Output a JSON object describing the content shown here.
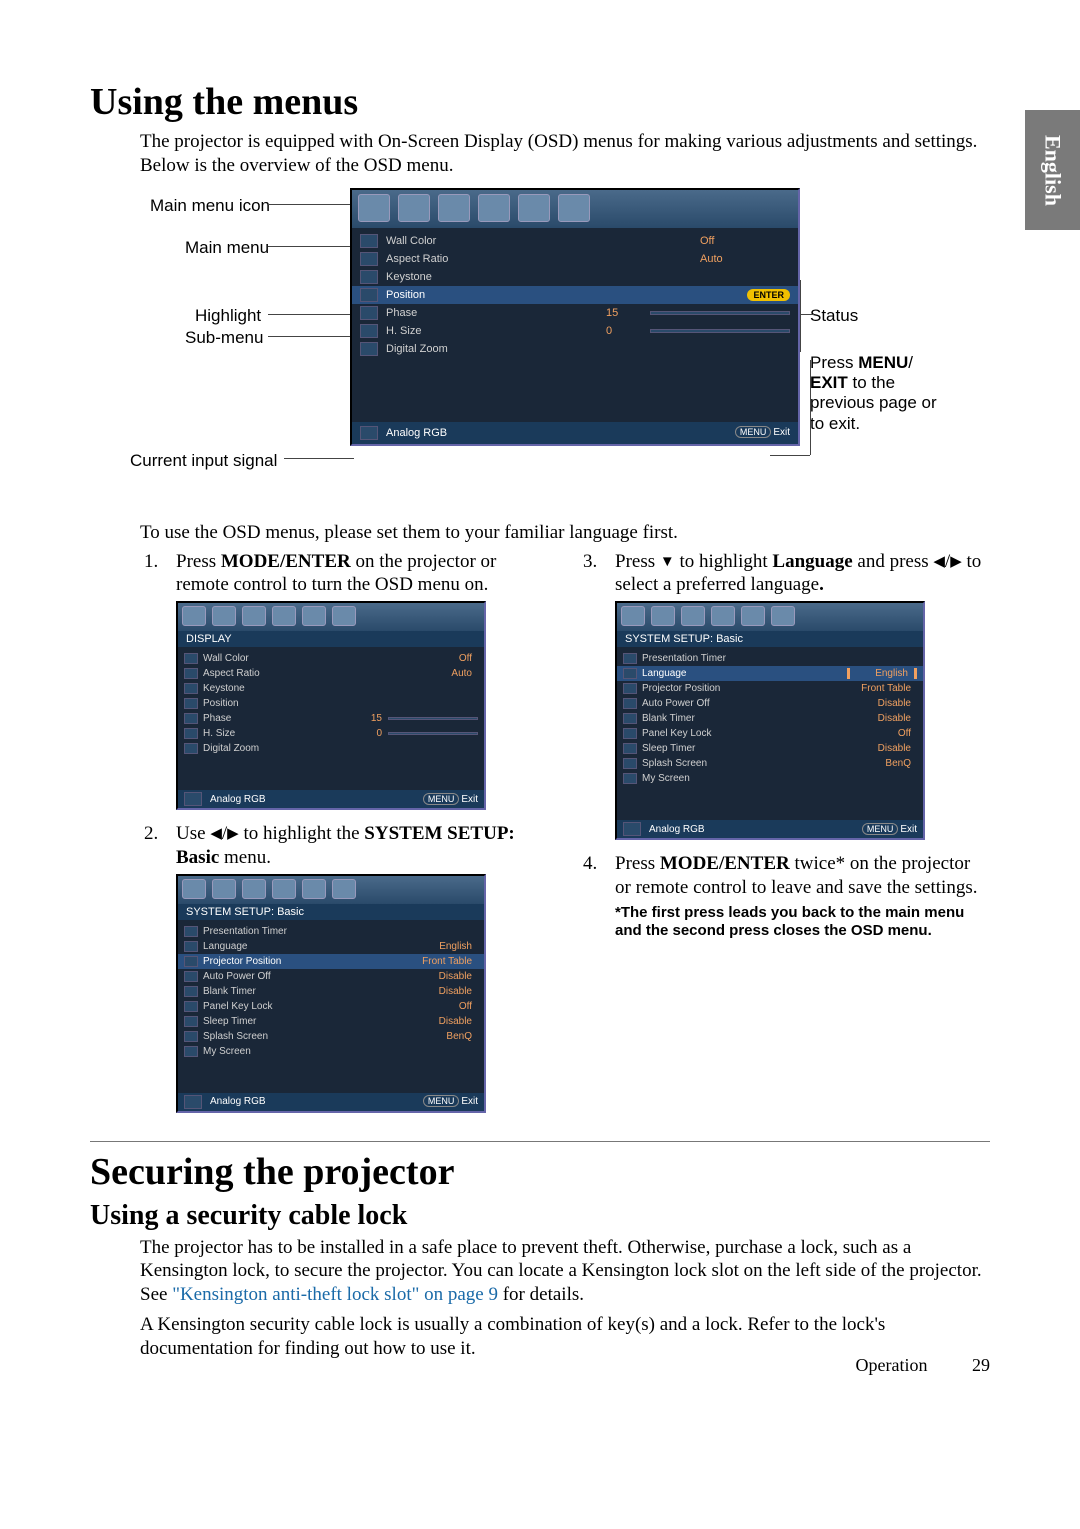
{
  "side_tab": "English",
  "heading1": "Using the menus",
  "intro1": "The projector is equipped with On-Screen Display (OSD) menus for making various adjustments and settings.",
  "intro2": "Below is the overview of the OSD menu.",
  "diagram_labels": {
    "main_menu_icon": "Main menu icon",
    "main_menu": "Main menu",
    "highlight": "Highlight",
    "sub_menu": "Sub-menu",
    "current_input_signal": "Current input signal",
    "status": "Status",
    "press_menu_exit": "Press MENU/EXIT to the previous page or to exit."
  },
  "main_osd": {
    "rows": [
      {
        "name": "Wall Color",
        "value": "Off",
        "type": "value"
      },
      {
        "name": "Aspect Ratio",
        "value": "Auto",
        "type": "value"
      },
      {
        "name": "Keystone",
        "value": "",
        "type": "plain"
      },
      {
        "name": "Position",
        "value": "ENTER",
        "type": "enter",
        "hl": true
      },
      {
        "name": "Phase",
        "value": "15",
        "type": "slider"
      },
      {
        "name": "H. Size",
        "value": "0",
        "type": "slider"
      },
      {
        "name": "Digital Zoom",
        "value": "",
        "type": "plain"
      }
    ],
    "footer_signal": "Analog RGB",
    "footer_menu": "MENU",
    "footer_exit": "Exit"
  },
  "below_text": "To use the OSD menus, please set them to your familiar language first.",
  "step1": {
    "num": "1.",
    "text_a": "Press ",
    "bold_a": "MODE/ENTER",
    "text_b": " on the projector or remote control to turn the OSD menu on."
  },
  "osd1": {
    "title": "DISPLAY",
    "rows": [
      {
        "name": "Wall Color",
        "value": "Off",
        "type": "value"
      },
      {
        "name": "Aspect Ratio",
        "value": "Auto",
        "type": "value"
      },
      {
        "name": "Keystone",
        "value": "",
        "type": "plain"
      },
      {
        "name": "Position",
        "value": "",
        "type": "plain"
      },
      {
        "name": "Phase",
        "value": "15",
        "type": "slider"
      },
      {
        "name": "H. Size",
        "value": "0",
        "type": "slider"
      },
      {
        "name": "Digital Zoom",
        "value": "",
        "type": "plain"
      }
    ],
    "footer_signal": "Analog RGB",
    "footer_menu": "MENU",
    "footer_exit": "Exit"
  },
  "step2": {
    "num": "2.",
    "text_a": "Use ",
    "text_b": " to highlight the ",
    "bold_a": "SYSTEM SETUP: Basic",
    "text_c": " menu."
  },
  "osd2": {
    "title": "SYSTEM SETUP: Basic",
    "rows": [
      {
        "name": "Presentation Timer",
        "value": "",
        "type": "plain"
      },
      {
        "name": "Language",
        "value": "English",
        "type": "value"
      },
      {
        "name": "Projector Position",
        "value": "Front Table",
        "type": "value",
        "hl": true
      },
      {
        "name": "Auto Power Off",
        "value": "Disable",
        "type": "value"
      },
      {
        "name": "Blank Timer",
        "value": "Disable",
        "type": "value"
      },
      {
        "name": "Panel Key Lock",
        "value": "Off",
        "type": "value"
      },
      {
        "name": "Sleep Timer",
        "value": "Disable",
        "type": "value"
      },
      {
        "name": "Splash Screen",
        "value": "BenQ",
        "type": "value"
      },
      {
        "name": "My Screen",
        "value": "",
        "type": "plain"
      }
    ],
    "footer_signal": "Analog RGB",
    "footer_menu": "MENU",
    "footer_exit": "Exit"
  },
  "step3": {
    "num": "3.",
    "text_a": "Press ",
    "text_b": " to highlight ",
    "bold_a": "Language",
    "text_c": " and press ",
    "text_d": " to select a preferred language",
    "text_e": "."
  },
  "osd3": {
    "title": "SYSTEM SETUP: Basic",
    "rows": [
      {
        "name": "Presentation Timer",
        "value": "",
        "type": "plain"
      },
      {
        "name": "Language",
        "value": "English",
        "type": "lang",
        "hl": true
      },
      {
        "name": "Projector Position",
        "value": "Front Table",
        "type": "value"
      },
      {
        "name": "Auto Power Off",
        "value": "Disable",
        "type": "value"
      },
      {
        "name": "Blank Timer",
        "value": "Disable",
        "type": "value"
      },
      {
        "name": "Panel Key Lock",
        "value": "Off",
        "type": "value"
      },
      {
        "name": "Sleep Timer",
        "value": "Disable",
        "type": "value"
      },
      {
        "name": "Splash Screen",
        "value": "BenQ",
        "type": "value"
      },
      {
        "name": "My Screen",
        "value": "",
        "type": "plain"
      }
    ],
    "footer_signal": "Analog RGB",
    "footer_menu": "MENU",
    "footer_exit": "Exit"
  },
  "step4": {
    "num": "4.",
    "text_a": "Press ",
    "bold_a": "MODE/ENTER",
    "text_b": " twice* on the projector or remote control to leave and save the settings."
  },
  "note4": "*The first press leads you back to the main menu and the second press closes the OSD menu.",
  "heading2": "Securing the projector",
  "heading2b": "Using a security cable lock",
  "sec_p1a": "The projector has to be installed in a safe place to prevent theft. Otherwise, purchase a lock, such as a Kensington lock, to secure the projector. You can locate a Kensington lock slot on the left side of the projector. See ",
  "sec_link": "\"Kensington anti-theft lock slot\" on page 9",
  "sec_p1b": " for details.",
  "sec_p2": "A Kensington security cable lock is usually a combination of key(s) and a lock. Refer to the lock's documentation for finding out how to use it.",
  "footer_section": "Operation",
  "footer_page": "29"
}
